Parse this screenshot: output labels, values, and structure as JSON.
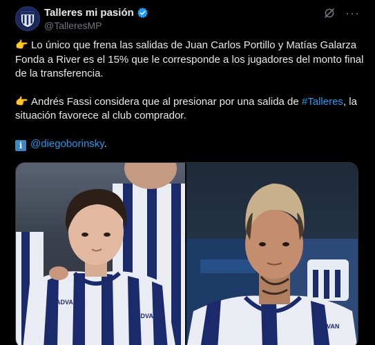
{
  "account": {
    "display_name": "Talleres mi pasión",
    "handle": "@TalleresMP",
    "verified": true,
    "avatar_icon": "club-crest-avatar"
  },
  "header_icons": [
    "grok-icon",
    "more-icon"
  ],
  "header": {
    "more_label": "···"
  },
  "tweet": {
    "p1": {
      "emoji": "👉",
      "text": "Lo único que frena las salidas de Juan Carlos Portillo y Matías Galarza Fonda a River es el 15% que le corresponde a los jugadores del monto final de la transferencia."
    },
    "p2": {
      "emoji": "👉",
      "text_before": "Andrés Fassi considera que al presionar por una salida de ",
      "hashtag": "#Talleres",
      "text_after": ", la situación favorece al club comprador."
    },
    "p3": {
      "info_glyph": "i",
      "mention": "@diegoborinsky",
      "text_after": "."
    }
  },
  "media": {
    "photos": [
      {
        "id": "player-photo-left",
        "jersey_text": [
          "ADVANTA",
          "ADVANTA"
        ]
      },
      {
        "id": "player-photo-right",
        "jersey_text": [
          "ADVAN"
        ]
      }
    ]
  },
  "colors": {
    "background": "#000000",
    "text": "#e7e9ea",
    "secondary_text": "#71767b",
    "link": "#1d9bf0",
    "verified": "#1d9bf0",
    "jersey_blue": "#1b2a6b"
  }
}
